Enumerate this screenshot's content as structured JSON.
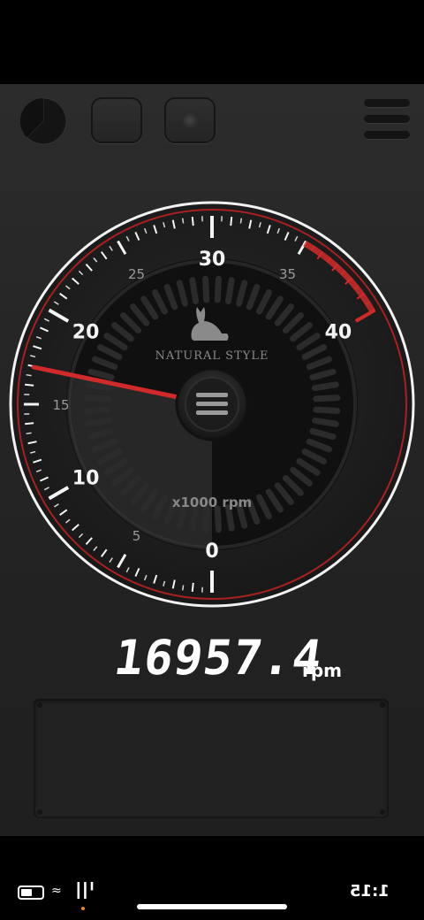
{
  "toolbar": {
    "pie_icon": "pie-chart-icon",
    "button_a_icon": "blank-button-icon",
    "button_b_icon": "record-dot-icon",
    "menu_icon": "hamburger-menu-icon"
  },
  "gauge": {
    "min": 0,
    "max": 40,
    "redline_start": 35,
    "major_labels": [
      {
        "value": 0,
        "text": "0"
      },
      {
        "value": 10,
        "text": "10"
      },
      {
        "value": 20,
        "text": "20"
      },
      {
        "value": 30,
        "text": "30"
      },
      {
        "value": 40,
        "text": "40"
      }
    ],
    "minor_labels": [
      {
        "value": 5,
        "text": "5"
      },
      {
        "value": 15,
        "text": "15"
      },
      {
        "value": 25,
        "text": "25"
      },
      {
        "value": 35,
        "text": "35"
      }
    ],
    "needle_value": 16.957,
    "brand": "NATURAL STYLE",
    "unit_label": "x1000 rpm",
    "accent_color": "#d02a2a",
    "brand_icon": "cat-silhouette-icon"
  },
  "readout": {
    "value": "16957.4",
    "unit": "rpm"
  },
  "status_bar": {
    "time": "1:15",
    "battery_icon": "battery-icon",
    "wifi_icon": "wifi-icon",
    "signal_icon": "signal-icon"
  }
}
